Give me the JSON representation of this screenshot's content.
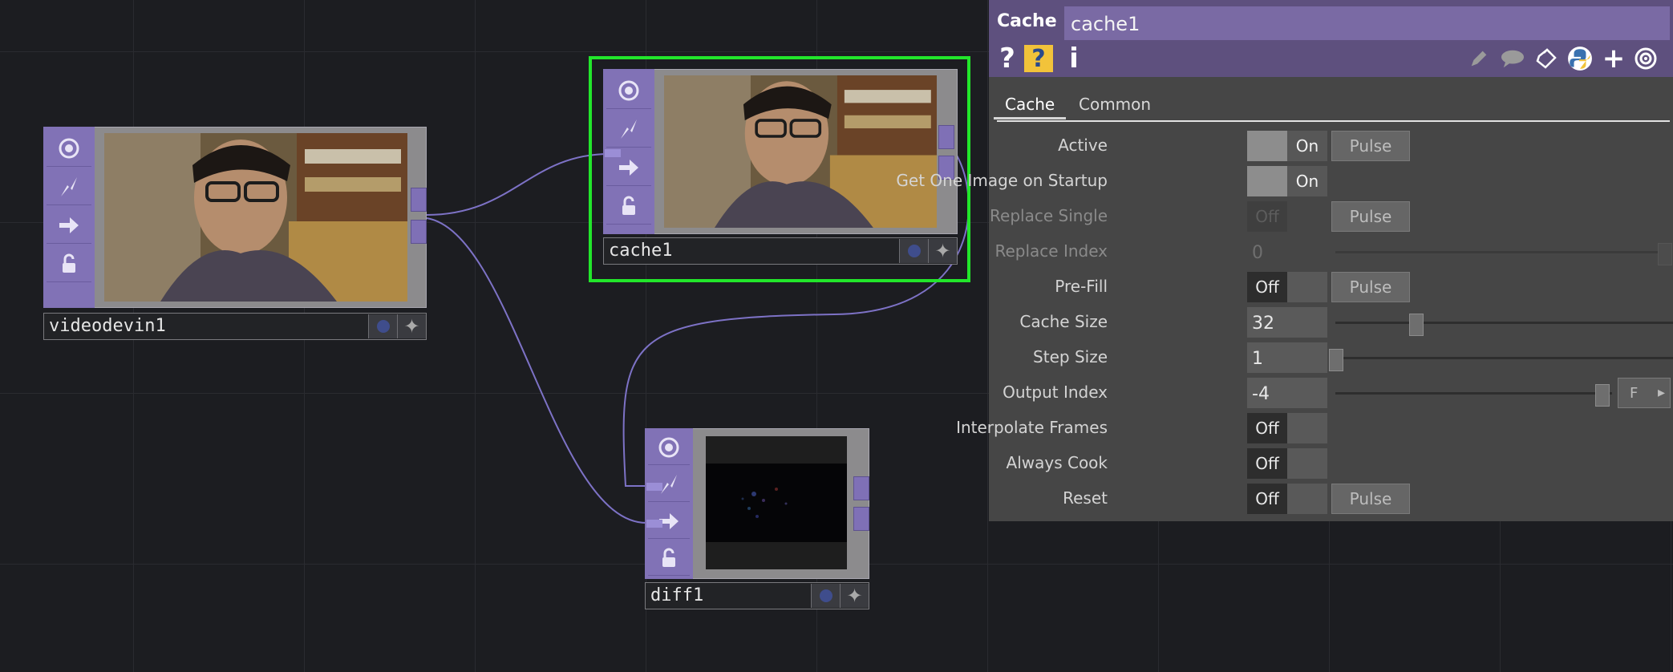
{
  "nodes": {
    "videodevin": {
      "label": "videodevin1"
    },
    "cache": {
      "label": "cache1"
    },
    "diff": {
      "label": "diff1"
    }
  },
  "panel": {
    "op_type": "Cache",
    "op_name": "cache1",
    "header_icons": [
      "help-icon",
      "python-help-icon",
      "info-icon",
      "edit-icon",
      "comment-icon",
      "clipboard-icon",
      "python-icon",
      "plus-icon",
      "target-icon"
    ],
    "tabs": [
      {
        "label": "Cache",
        "active": true
      },
      {
        "label": "Common",
        "active": false
      }
    ],
    "params": {
      "active": {
        "label": "Active",
        "state": "On",
        "pulse": "Pulse"
      },
      "get_one_image": {
        "label": "Get One Image on Startup",
        "state": "On"
      },
      "replace_single": {
        "label": "Replace Single",
        "state": "Off",
        "pulse": "Pulse"
      },
      "replace_index": {
        "label": "Replace Index",
        "value": "0"
      },
      "pre_fill": {
        "label": "Pre-Fill",
        "state": "Off",
        "pulse": "Pulse"
      },
      "cache_size": {
        "label": "Cache Size",
        "value": "32"
      },
      "step_size": {
        "label": "Step Size",
        "value": "1"
      },
      "output_index": {
        "label": "Output Index",
        "value": "-4",
        "button": "F"
      },
      "interpolate": {
        "label": "Interpolate Frames",
        "state": "Off"
      },
      "always_cook": {
        "label": "Always Cook",
        "state": "Off"
      },
      "reset": {
        "label": "Reset",
        "state": "Off",
        "pulse": "Pulse"
      }
    }
  },
  "colors": {
    "operator": "#8172b6",
    "selection": "#22e62b",
    "panel_header": "#5e507e",
    "wire": "#7d72c6"
  }
}
